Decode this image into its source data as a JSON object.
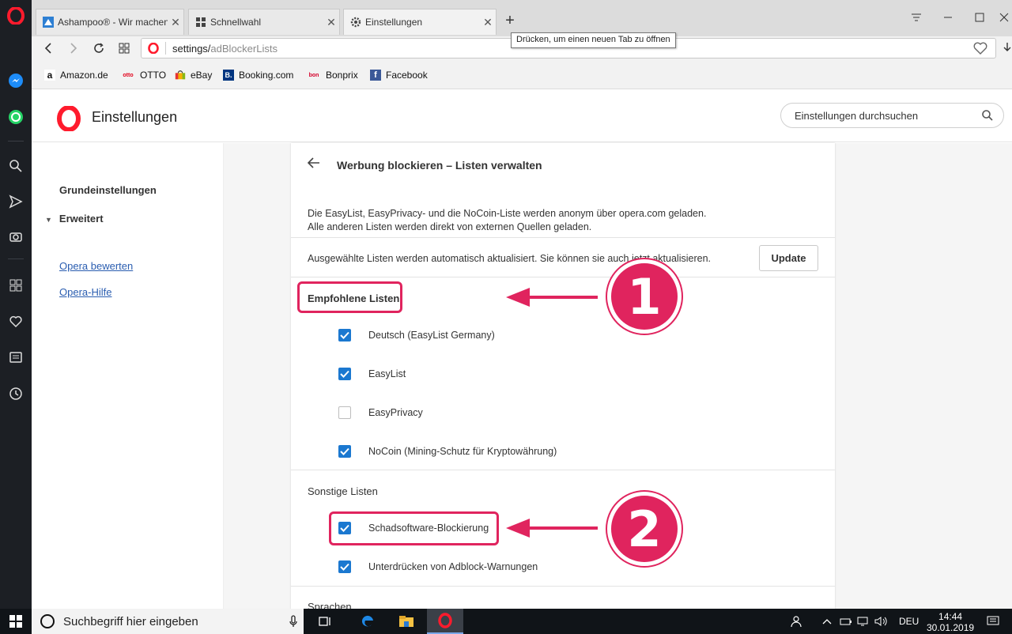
{
  "colors": {
    "accent": "#1b78d0",
    "annotation": "#e0245e",
    "opera_red": "#ff1b2d"
  },
  "sidebar": {
    "icons": [
      "opera-icon",
      "messenger-icon",
      "whatsapp-icon",
      "search-icon",
      "send-icon",
      "camera-icon",
      "speed-dial-icon",
      "heart-icon",
      "news-icon",
      "history-icon"
    ]
  },
  "tabs": [
    {
      "label": "Ashampoo® - Wir machen",
      "icon": "ashampoo-icon"
    },
    {
      "label": "Schnellwahl",
      "icon": "grid-icon"
    },
    {
      "label": "Einstellungen",
      "icon": "gear-icon"
    }
  ],
  "tooltip": "Drücken, um einen neuen Tab zu öffnen",
  "address": {
    "host": "settings/",
    "path": "adBlockerLists"
  },
  "bookmarks": [
    {
      "label": "Amazon.de"
    },
    {
      "label": "OTTO"
    },
    {
      "label": "eBay"
    },
    {
      "label": "Booking.com"
    },
    {
      "label": "Bonprix"
    },
    {
      "label": "Facebook"
    }
  ],
  "settings": {
    "title": "Einstellungen",
    "search_placeholder": "Einstellungen durchsuchen"
  },
  "nav": {
    "basic": "Grundeinstellungen",
    "advanced": "Erweitert",
    "rate": "Opera bewerten",
    "help": "Opera-Hilfe"
  },
  "page": {
    "title": "Werbung blockieren – Listen verwalten",
    "desc1": "Die EasyList, EasyPrivacy- und die NoCoin-Liste werden anonym über opera.com geladen.",
    "desc2": "Alle anderen Listen werden direkt von externen Quellen geladen.",
    "update_text": "Ausgewählte Listen werden automatisch aktualisiert. Sie können sie auch jetzt aktualisieren.",
    "update_button": "Update",
    "recommended_heading": "Empfohlene Listen",
    "recommended": [
      {
        "label": "Deutsch (EasyList Germany)",
        "checked": true
      },
      {
        "label": "EasyList",
        "checked": true
      },
      {
        "label": "EasyPrivacy",
        "checked": false
      },
      {
        "label": "NoCoin (Mining-Schutz für Kryptowährung)",
        "checked": true
      }
    ],
    "other_heading": "Sonstige Listen",
    "other": [
      {
        "label": "Schadsoftware-Blockierung",
        "checked": true
      },
      {
        "label": "Unterdrücken von Adblock-Warnungen",
        "checked": true
      }
    ],
    "languages_heading": "Sprachen"
  },
  "annotations": {
    "one": "1",
    "two": "2"
  },
  "taskbar": {
    "search_placeholder": "Suchbegriff hier eingeben",
    "lang": "DEU",
    "time": "14:44",
    "date": "30.01.2019"
  }
}
